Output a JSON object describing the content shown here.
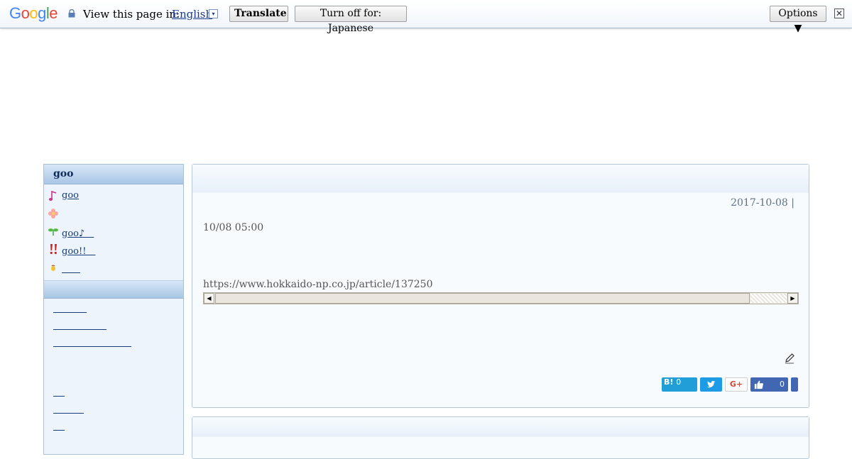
{
  "translate_bar": {
    "logo": "Google",
    "prompt": "View this page in:",
    "language": "English",
    "dropdown": "▾",
    "translate_label": "Translate",
    "turn_off_label": "Turn off for: Japanese",
    "options_label": "Options ▼",
    "close_glyph": "✕"
  },
  "sidebar": {
    "header": "goo",
    "items": [
      {
        "icon": "music-note-icon",
        "label": "goo"
      },
      {
        "icon": "flower-icon",
        "label": ""
      },
      {
        "icon": "sprout-icon",
        "label": "goo♪　"
      },
      {
        "icon": "double-exclamation-icon",
        "label": "goo!!　"
      },
      {
        "icon": "acorn-icon",
        "label": "　　"
      }
    ]
  },
  "entry": {
    "date": "2017-10-08 |",
    "time": "10/08 05:00",
    "url": "https://www.hokkaido-np.co.jp/article/137250",
    "share": {
      "hatena_label": "B!",
      "hatena_count": "0",
      "fb_count": "0",
      "gplus_label": "G+"
    }
  },
  "colors": {
    "accent": "#163d79",
    "sidebar_bg": "#edf4fb",
    "hatena": "#1f9ed8",
    "twitter": "#1d9be4",
    "facebook": "#4267b2"
  }
}
